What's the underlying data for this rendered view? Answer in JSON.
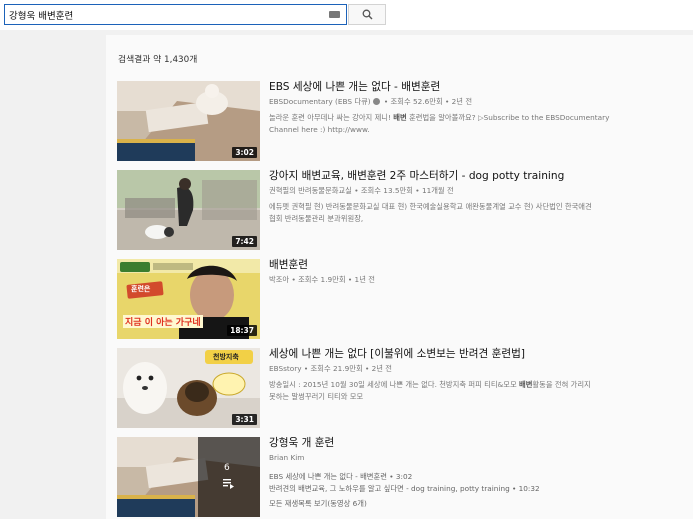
{
  "search": {
    "query": "강형욱 배변훈련"
  },
  "results_header": "검색결과 약 1,430개",
  "videos": [
    {
      "title": "EBS 세상에 나쁜 개는 없다 - 배변훈련",
      "channel": "EBSDocumentary (EBS 다큐)",
      "views": "조회수 52.6만회",
      "age": "2년 전",
      "desc_line1": "놀라운 훈련 아무데나 싸는 강아지 제니! ",
      "desc_bold": "배변",
      "desc_line1b": " 훈련법을 알아볼까요? ▷Subscribe to the EBSDocumentary",
      "desc_line2": "Channel here :) http://www.",
      "duration": "3:02"
    },
    {
      "title": "강아지 배변교육, 배변훈련 2주 마스터하기 - dog potty training",
      "channel": "권혁필의 반려동물문화교실",
      "views": "조회수 13.5만회",
      "age": "11개월 전",
      "desc_line1": "에듀펫 권혁필 현) 반려동물문화교실 대표 현) 한국예술실용학교 애완동물계열 교수 현) 사단법인 한국애견",
      "desc_line2": "협회 반려동물관리 분과위원장,",
      "duration": "7:42"
    },
    {
      "title": "배변훈련",
      "channel": "박조아",
      "views": "조회수 1.9만회",
      "age": "1년 전",
      "duration": "18:37",
      "thumb_caption_line1": "훈련은",
      "thumb_caption_line2": "지금 이 아는 가구네"
    },
    {
      "title": "세상에 나쁜 개는 없다 [이불위에 소변보는 반려견 훈련법]",
      "channel": "EBSstory",
      "views": "조회수 21.9만회",
      "age": "2년 전",
      "desc_line1": "방송일시 : 2015년 10월 30일 세상에 나쁜 개는 없다. 천방지축 퍼피 티티&모모 ",
      "desc_bold": "배변",
      "desc_line1b": "활동을 전혀 가리지",
      "desc_line2": "못하는 말썽꾸러기 티티와 모모",
      "duration": "3:31",
      "thumb_label": "천방지축"
    }
  ],
  "playlist": {
    "title": "강형욱 개 훈련",
    "channel": "Brian Kim",
    "video_count": "6",
    "entry1": "EBS 세상에 나쁜 개는 없다 - 배변훈련 • 3:02",
    "entry2": "반려견의 배변교육, 그 노하우를 알고 싶다면 - dog training, potty training • 10:32",
    "view_all": "모든 재생목록 보기(동영상 6개)"
  },
  "colors": {
    "search_border": "#1c62b9",
    "page_bg": "#fafafa",
    "outer_bg": "#f1f1f1"
  }
}
